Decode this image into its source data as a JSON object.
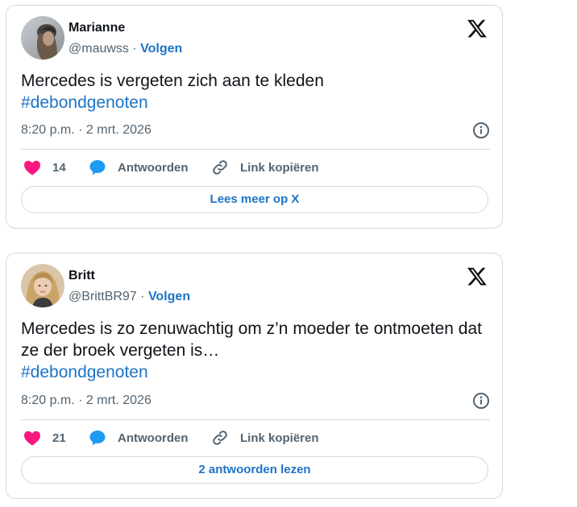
{
  "colors": {
    "link": "#1d74c6",
    "like": "#f91880",
    "reply": "#1d9bf0",
    "muted": "#536471",
    "border": "#cfd9de"
  },
  "tweets": [
    {
      "author": "Marianne",
      "handle": "@mauwss",
      "separator": " · ",
      "follow_label": "Volgen",
      "text": "Mercedes is vergeten zich aan te kleden",
      "hashtag": "#debondgenoten",
      "timestamp": "8:20 p.m. · 2 mrt. 2026",
      "likes": "14",
      "reply_label": "Antwoorden",
      "copy_label": "Link kopiëren",
      "more_label": "Lees meer op X",
      "avatar_icon": "avatar-photo",
      "brand_icon": "x-logo-icon",
      "info_icon": "info-icon"
    },
    {
      "author": "Britt",
      "handle": "@BrittBR97",
      "separator": " · ",
      "follow_label": "Volgen",
      "text": "Mercedes is zo zenuwachtig om z’n moeder te ontmoeten dat ze der broek vergeten is…",
      "hashtag": "#debondgenoten",
      "timestamp": "8:20 p.m. · 2 mrt. 2026",
      "likes": "21",
      "reply_label": "Antwoorden",
      "copy_label": "Link kopiëren",
      "more_label": "2 antwoorden lezen",
      "avatar_icon": "avatar-photo",
      "brand_icon": "x-logo-icon",
      "info_icon": "info-icon"
    }
  ]
}
